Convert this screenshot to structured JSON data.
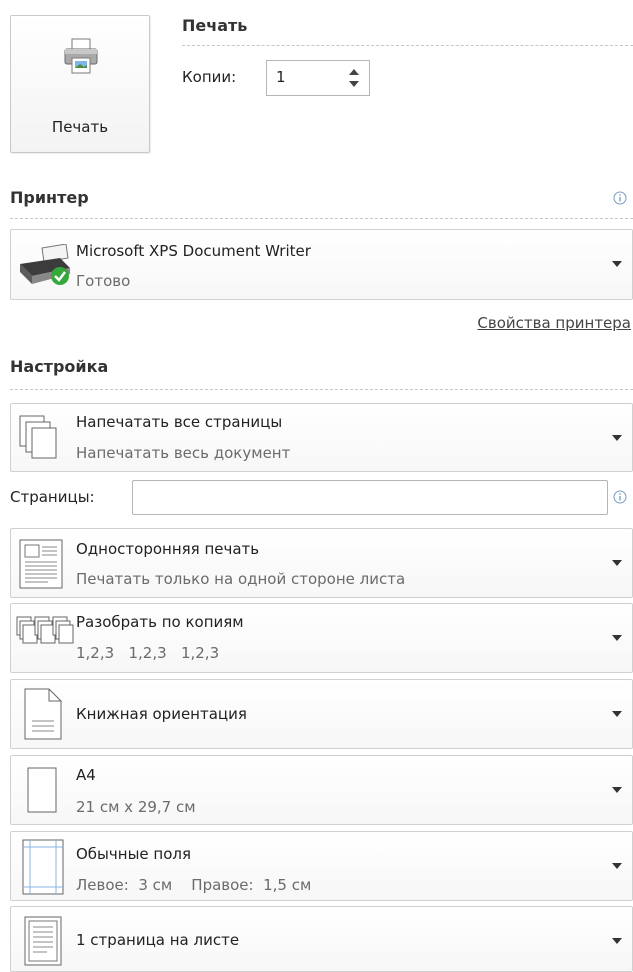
{
  "print_section": {
    "button_label": "Печать",
    "title": "Печать",
    "copies_label": "Копии:",
    "copies_value": "1"
  },
  "printer_section": {
    "title": "Принтер",
    "printer_name": "Microsoft XPS Document Writer",
    "printer_status": "Готово",
    "properties_link": "Свойства принтера"
  },
  "settings_section": {
    "title": "Настройка",
    "pages_label": "Страницы:",
    "pages_value": "",
    "options": [
      {
        "title": "Напечатать все страницы",
        "subtitle": "Напечатать весь документ",
        "icon": "pages-stack-icon"
      },
      {
        "title": "Односторонняя печать",
        "subtitle": "Печатать только на одной стороне листа",
        "icon": "single-sided-icon"
      },
      {
        "title": "Разобрать по копиям",
        "subtitle": "1,2,3   1,2,3   1,2,3",
        "icon": "collate-icon"
      },
      {
        "title": "Книжная ориентация",
        "subtitle": "",
        "icon": "portrait-orientation-icon"
      },
      {
        "title": "A4",
        "subtitle": "21 см x 29,7 см",
        "icon": "paper-size-icon"
      },
      {
        "title": "Обычные поля",
        "subtitle": "Левое:  3 см    Правое:  1,5 см",
        "icon": "margins-icon"
      },
      {
        "title": "1 страница на листе",
        "subtitle": "",
        "icon": "pages-per-sheet-icon"
      }
    ]
  },
  "colors": {
    "accent": "#3c8dd6",
    "status_green": "#35a83b",
    "border": "#d0d0d0"
  }
}
